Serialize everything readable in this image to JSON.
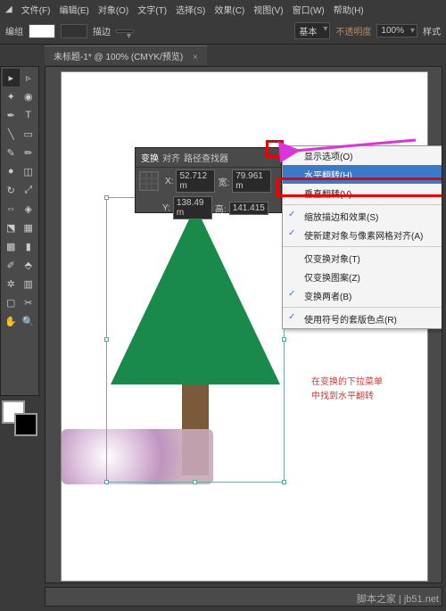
{
  "menu": {
    "items": [
      "文件(F)",
      "编辑(E)",
      "对象(O)",
      "文字(T)",
      "选择(S)",
      "效果(C)",
      "视图(V)",
      "窗口(W)",
      "帮助(H)"
    ]
  },
  "control": {
    "label": "编组",
    "stroke": "描边",
    "stroke_val": "",
    "style": "样式",
    "basic": "基本",
    "opacity_label": "不透明度",
    "opacity": "100%"
  },
  "tab": {
    "title": "未标题-1* @ 100% (CMYK/预览)",
    "close": "×"
  },
  "panel": {
    "tabs": [
      "变换",
      "对齐",
      "路径查找器"
    ],
    "x_label": "X:",
    "x": "52.712 m",
    "w_label": "宽:",
    "w": "79.961 m",
    "y_label": "Y:",
    "y": "138.49 m",
    "h_label": "高:",
    "h": "141.415 "
  },
  "fly": {
    "items": [
      {
        "t": "显示选项(O)",
        "c": false
      },
      {
        "t": "水平翻转(H)",
        "c": false,
        "hl": true
      },
      {
        "t": "垂直翻转(V)",
        "c": false
      },
      {
        "t": "缩放描边和效果(S)",
        "c": true,
        "sep": true
      },
      {
        "t": "使新建对象与像素网格对齐(A)",
        "c": true
      },
      {
        "t": "仅变换对象(T)",
        "c": false,
        "sep": true
      },
      {
        "t": "仅变换图案(Z)",
        "c": false
      },
      {
        "t": "变换两者(B)",
        "c": true
      },
      {
        "t": "使用符号的套版色点(R)",
        "c": true,
        "sep": true
      }
    ]
  },
  "annotation": {
    "l1": "在变换的下拉菜单",
    "l2": "中找到水平翻转"
  },
  "status": {
    "watermark": "脚本之家 | jb51.net"
  }
}
